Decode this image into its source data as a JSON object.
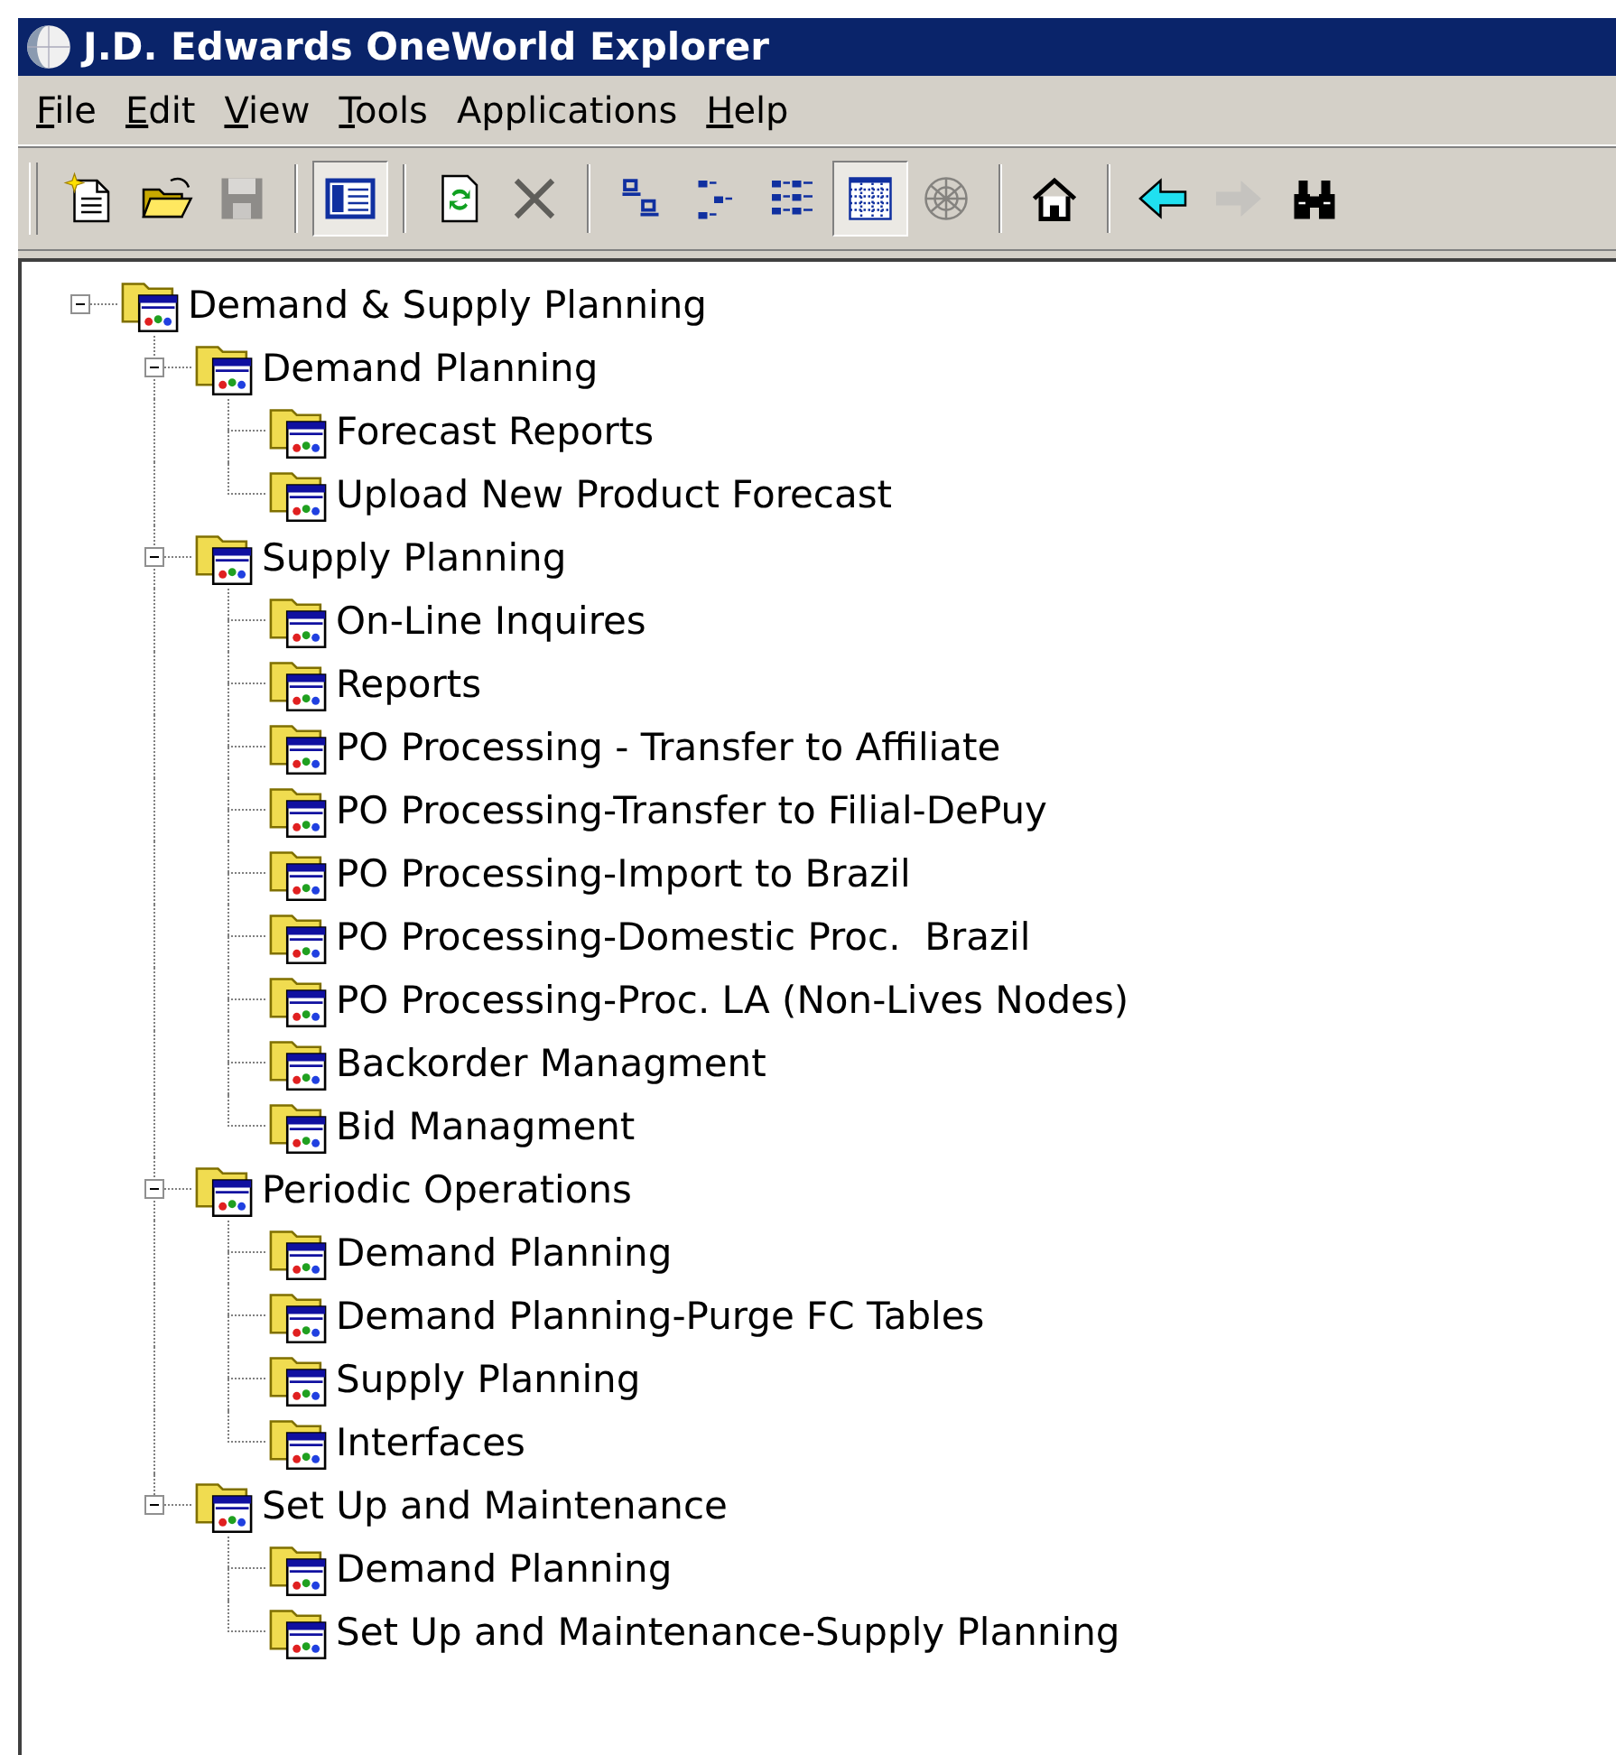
{
  "window": {
    "title": "J.D. Edwards OneWorld Explorer"
  },
  "menu": [
    {
      "label": "File",
      "underline_first": true
    },
    {
      "label": "Edit",
      "underline_first": true
    },
    {
      "label": "View",
      "underline_first": true
    },
    {
      "label": "Tools",
      "underline_first": true
    },
    {
      "label": "Applications",
      "underline_first": false
    },
    {
      "label": "Help",
      "underline_first": true
    }
  ],
  "toolbar": {
    "groups": [
      [
        {
          "disabled": false,
          "pressed": false
        },
        {
          "disabled": false,
          "pressed": false
        },
        {
          "disabled": true,
          "pressed": false
        }
      ],
      [
        {
          "disabled": false,
          "pressed": true
        }
      ],
      [
        {
          "disabled": false,
          "pressed": false
        },
        {
          "disabled": true,
          "pressed": false
        }
      ],
      [
        {
          "disabled": false,
          "pressed": false
        },
        {
          "disabled": false,
          "pressed": false
        },
        {
          "disabled": false,
          "pressed": false
        },
        {
          "disabled": false,
          "pressed": true
        },
        {
          "disabled": true,
          "pressed": false
        }
      ],
      [
        {
          "disabled": false,
          "pressed": false
        }
      ],
      [
        {
          "disabled": false,
          "pressed": false
        },
        {
          "disabled": true,
          "pressed": false
        },
        {
          "disabled": false,
          "pressed": false
        }
      ]
    ]
  },
  "tree": [
    {
      "label": "Demand & Supply Planning",
      "expanded": true,
      "children": [
        {
          "label": "Demand Planning",
          "expanded": true,
          "children": [
            {
              "label": "Forecast Reports"
            },
            {
              "label": "Upload New Product Forecast"
            }
          ]
        },
        {
          "label": "Supply Planning",
          "expanded": true,
          "children": [
            {
              "label": "On-Line Inquires"
            },
            {
              "label": "Reports"
            },
            {
              "label": "PO Processing - Transfer to Affiliate"
            },
            {
              "label": "PO Processing-Transfer to Filial-DePuy"
            },
            {
              "label": "PO Processing-Import to Brazil"
            },
            {
              "label": "PO Processing-Domestic Proc.  Brazil"
            },
            {
              "label": "PO Processing-Proc. LA (Non-Lives Nodes)"
            },
            {
              "label": "Backorder Managment"
            },
            {
              "label": "Bid Managment"
            }
          ]
        },
        {
          "label": "Periodic Operations",
          "expanded": true,
          "children": [
            {
              "label": "Demand Planning"
            },
            {
              "label": "Demand Planning-Purge FC Tables"
            },
            {
              "label": "Supply Planning"
            },
            {
              "label": "Interfaces"
            }
          ]
        },
        {
          "label": "Set Up and Maintenance",
          "expanded": true,
          "children": [
            {
              "label": "Demand Planning"
            },
            {
              "label": "Set Up and Maintenance-Supply Planning"
            }
          ]
        }
      ]
    }
  ]
}
